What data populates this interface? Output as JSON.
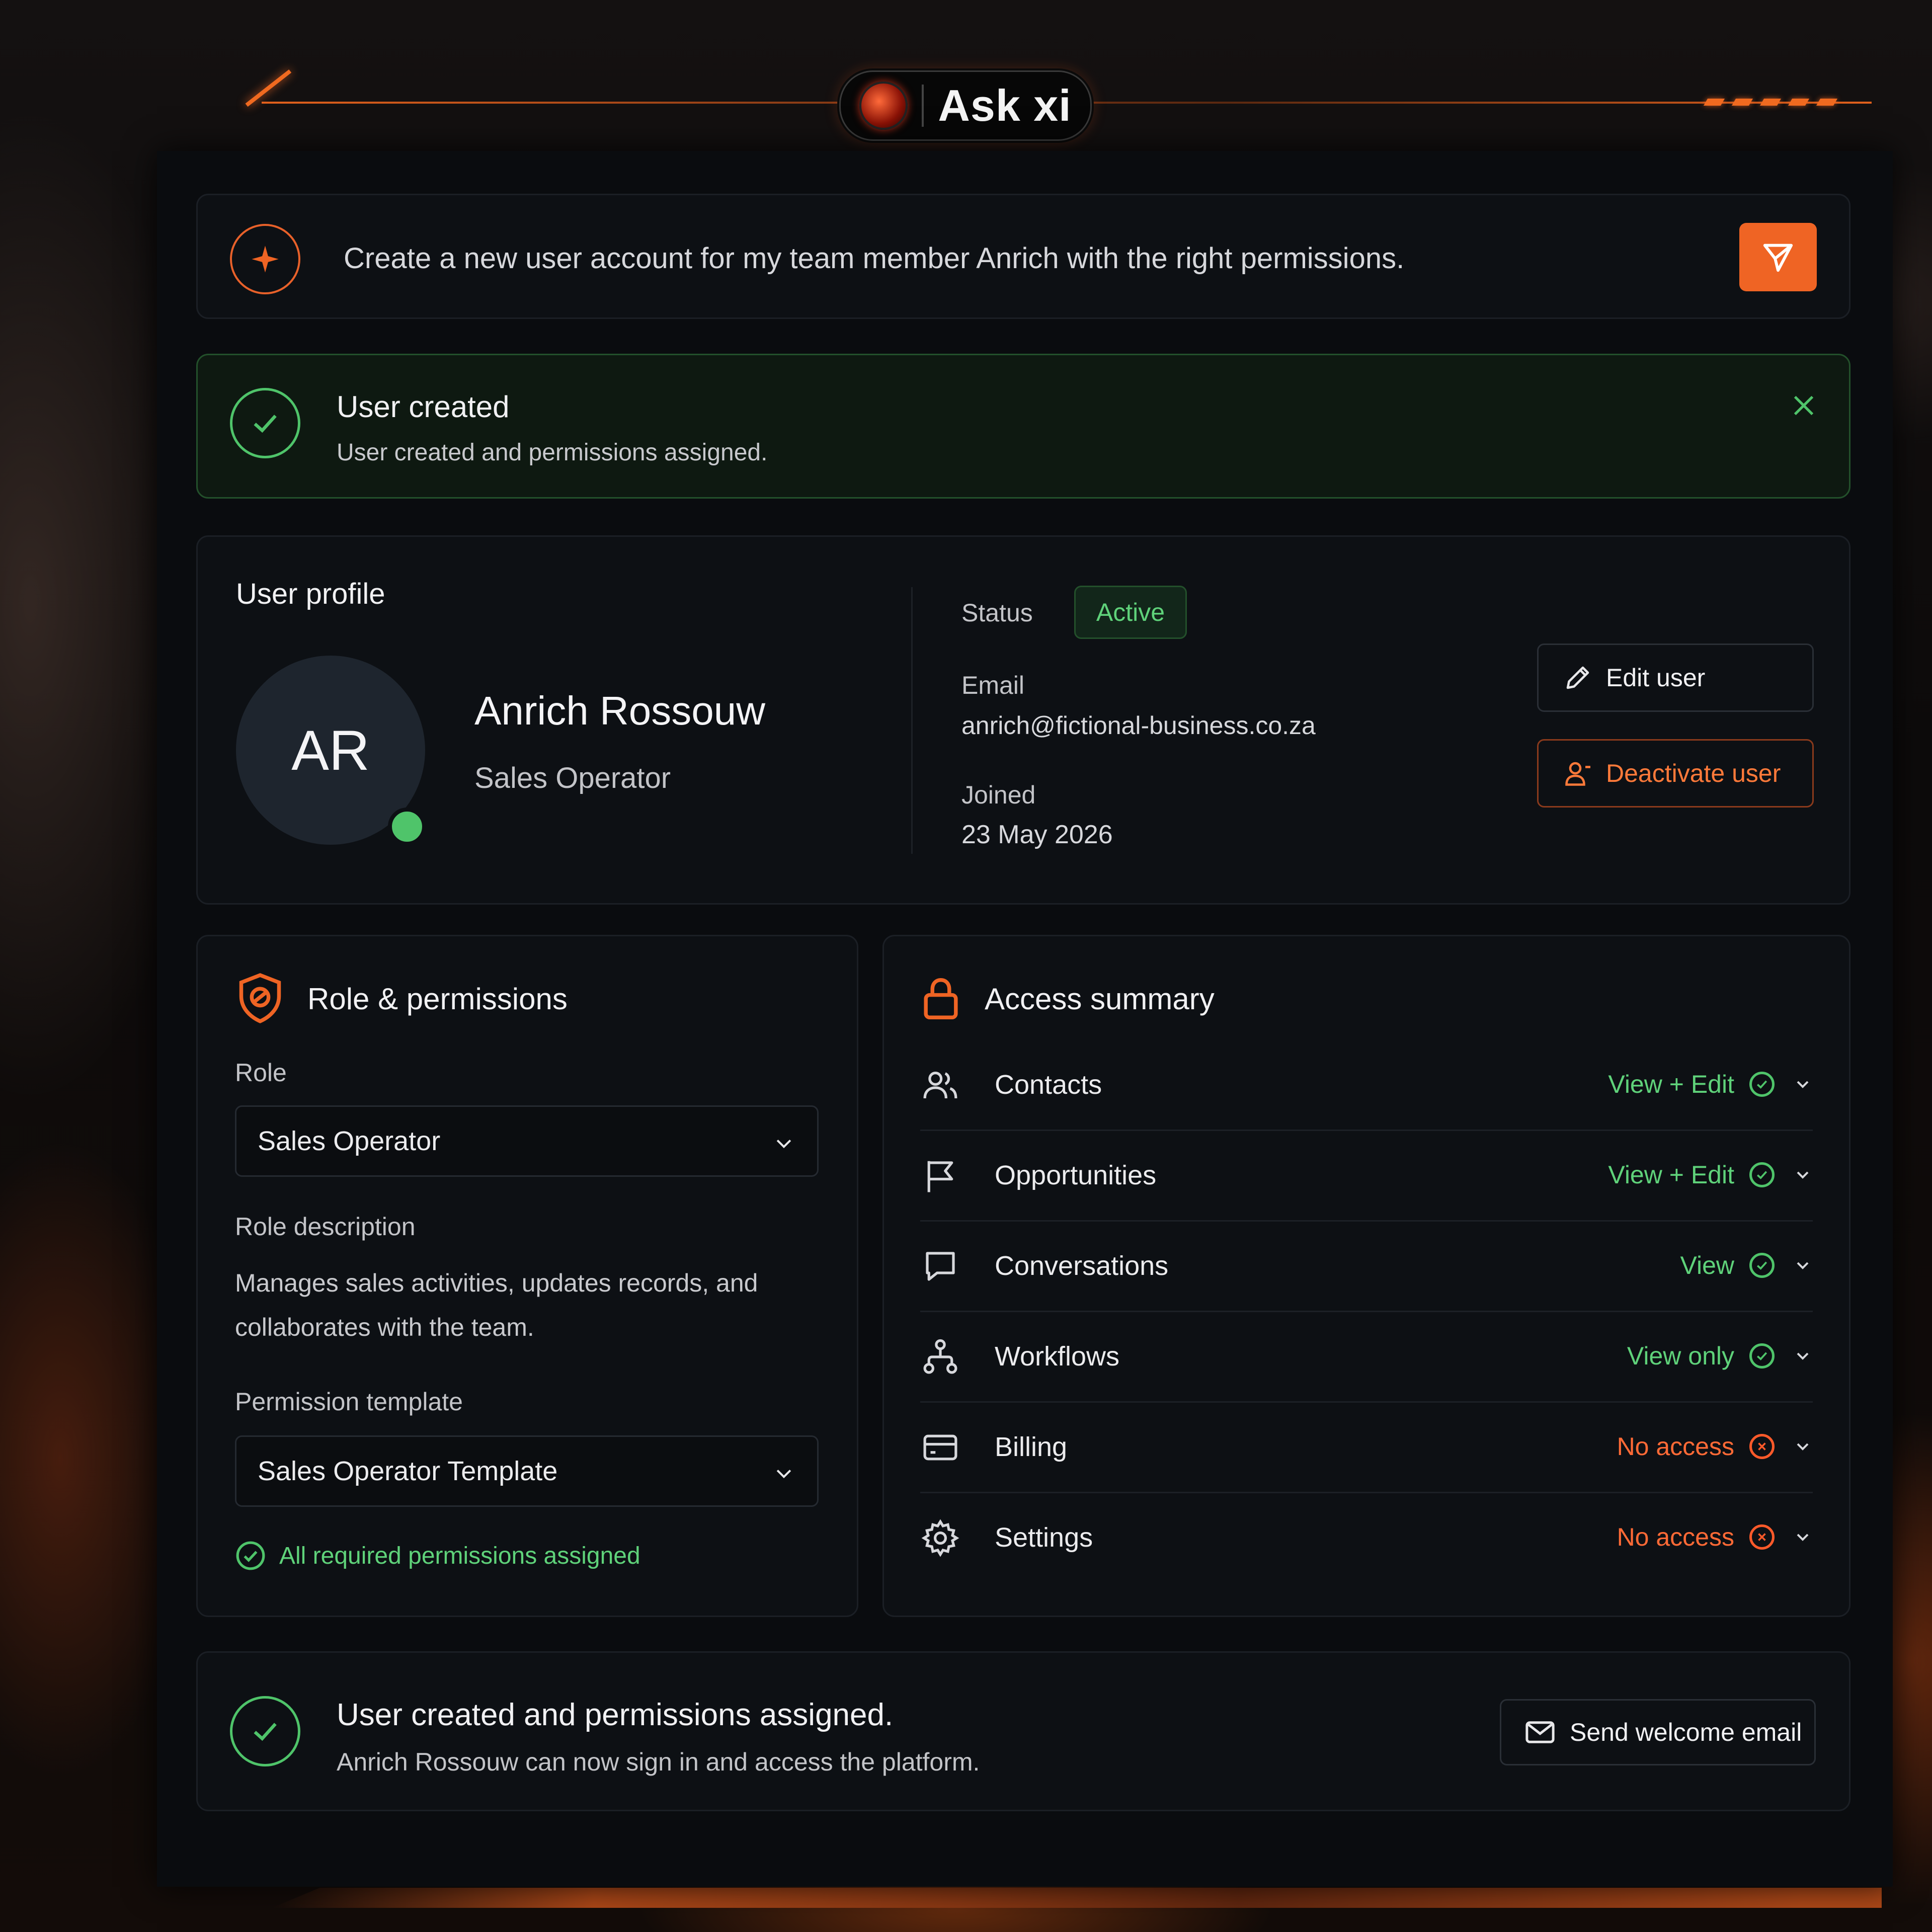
{
  "brand": {
    "name": "Ask xi"
  },
  "prompt": {
    "text": "Create a new user account for my team member Anrich with the right permissions."
  },
  "notification": {
    "title": "User created",
    "message": "User created and permissions assigned."
  },
  "profile": {
    "heading": "User profile",
    "initials": "AR",
    "name": "Anrich Rossouw",
    "role": "Sales Operator",
    "status_label": "Status",
    "status_value": "Active",
    "email_label": "Email",
    "email_value": "anrich@fictional-business.co.za",
    "joined_label": "Joined",
    "joined_value": "23 May 2026",
    "edit_label": "Edit user",
    "deactivate_label": "Deactivate user"
  },
  "role_permissions": {
    "heading": "Role & permissions",
    "role_label": "Role",
    "role_value": "Sales Operator",
    "description_label": "Role description",
    "description": "Manages sales activities, updates records, and collaborates with the team.",
    "template_label": "Permission template",
    "template_value": "Sales Operator Template",
    "status_text": "All required permissions assigned"
  },
  "access_summary": {
    "heading": "Access summary",
    "rows": [
      {
        "name": "Contacts",
        "level": "View + Edit",
        "granted": true,
        "icon": "users-icon"
      },
      {
        "name": "Opportunities",
        "level": "View + Edit",
        "granted": true,
        "icon": "flag-icon"
      },
      {
        "name": "Conversations",
        "level": "View",
        "granted": true,
        "icon": "chat-icon"
      },
      {
        "name": "Workflows",
        "level": "View only",
        "granted": true,
        "icon": "workflow-icon"
      },
      {
        "name": "Billing",
        "level": "No access",
        "granted": false,
        "icon": "credit-card-icon"
      },
      {
        "name": "Settings",
        "level": "No access",
        "granted": false,
        "icon": "gear-icon"
      }
    ]
  },
  "footer": {
    "title": "User created and permissions assigned.",
    "message": "Anrich Rossouw can now sign in and access the platform.",
    "button_label": "Send welcome email"
  },
  "colors": {
    "accent": "#ef6424",
    "success": "#4fc46a",
    "danger": "#ff5a2a",
    "panel": "#0a0c0f"
  }
}
